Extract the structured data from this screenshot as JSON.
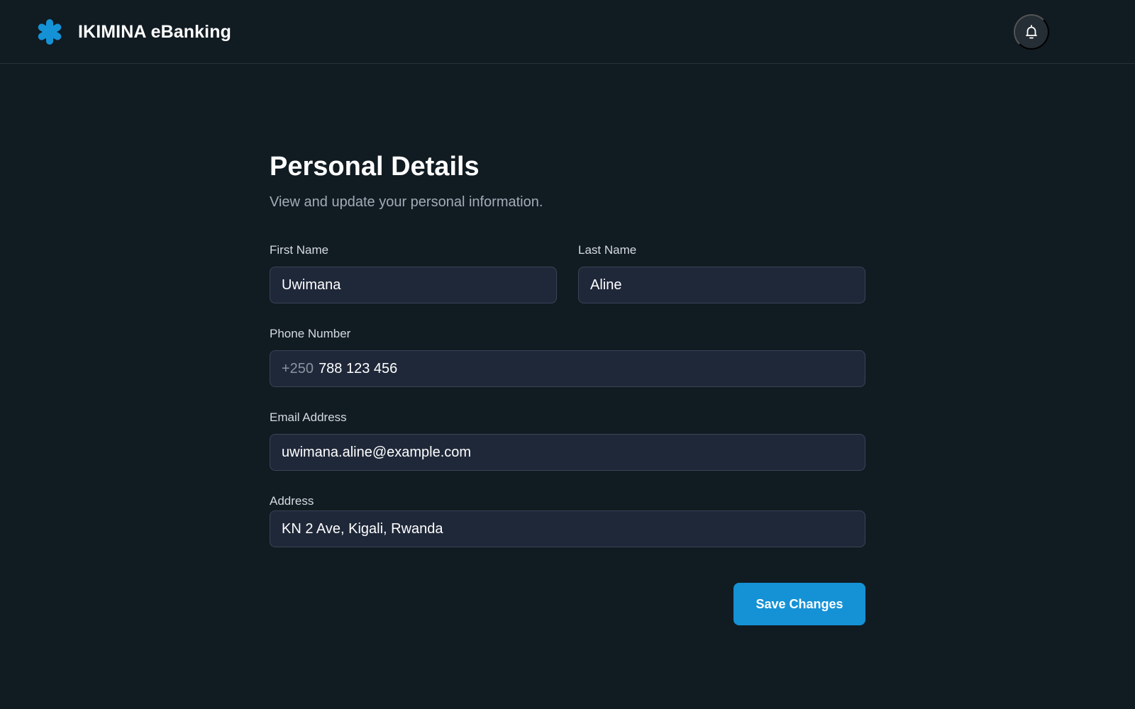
{
  "app": {
    "name": "IKIMINA eBanking",
    "logo_icon": "asterisk-logo-icon",
    "accent_color": "#1592d6"
  },
  "header": {
    "notification_icon": "bell-icon"
  },
  "page": {
    "title": "Personal Details",
    "subtitle": "View and update your personal information."
  },
  "form": {
    "first_name": {
      "label": "First Name",
      "value": "Uwimana"
    },
    "last_name": {
      "label": "Last Name",
      "value": "Aline"
    },
    "phone": {
      "label": "Phone Number",
      "prefix": "+250",
      "value": "788 123 456"
    },
    "email": {
      "label": "Email Address",
      "value": "uwimana.aline@example.com"
    },
    "address": {
      "label": "Address",
      "value": "KN 2 Ave, Kigali, Rwanda"
    },
    "save_label": "Save Changes"
  }
}
